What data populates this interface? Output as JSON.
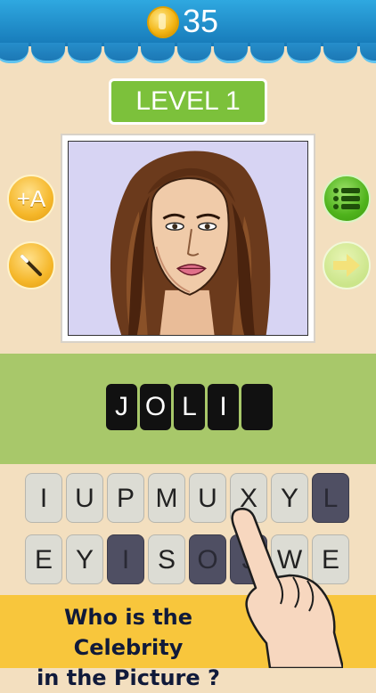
{
  "header": {
    "coins": "35",
    "coin_icon": "gold-coin-icon"
  },
  "level": {
    "label": "LEVEL 1"
  },
  "side_buttons": {
    "reveal_letter": "+A",
    "remove_letters_icon": "wand-icon",
    "menu_icon": "list-menu-icon",
    "next_icon": "arrow-right-icon"
  },
  "answer": {
    "letters": [
      "J",
      "O",
      "L",
      "I",
      ""
    ]
  },
  "keyboard": {
    "row1": [
      {
        "letter": "I",
        "used": false
      },
      {
        "letter": "U",
        "used": false
      },
      {
        "letter": "P",
        "used": false
      },
      {
        "letter": "M",
        "used": false
      },
      {
        "letter": "U",
        "used": false
      },
      {
        "letter": "X",
        "used": false
      },
      {
        "letter": "Y",
        "used": false
      },
      {
        "letter": "L",
        "used": true
      }
    ],
    "row2": [
      {
        "letter": "E",
        "used": false
      },
      {
        "letter": "Y",
        "used": false
      },
      {
        "letter": "I",
        "used": true
      },
      {
        "letter": "S",
        "used": false
      },
      {
        "letter": "O",
        "used": true
      },
      {
        "letter": "J",
        "used": true
      },
      {
        "letter": "W",
        "used": false
      },
      {
        "letter": "E",
        "used": false
      }
    ]
  },
  "banner": {
    "line1": "Who is the Celebrity",
    "line2": "in the Picture ?"
  },
  "colors": {
    "background": "#f3dfbf",
    "header": "#1b88c8",
    "level_badge": "#7cc13b",
    "answer_band": "#a8c86a",
    "banner": "#f8c63c"
  }
}
